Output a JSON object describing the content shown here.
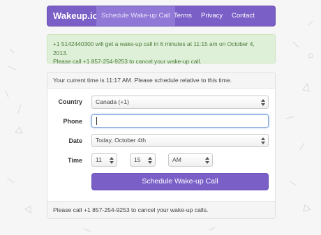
{
  "nav": {
    "brand": "Wakeup.io",
    "items": [
      {
        "label": "Schedule Wake-up Call",
        "active": true
      },
      {
        "label": "Terms",
        "active": false
      },
      {
        "label": "Privacy",
        "active": false
      },
      {
        "label": "Contact",
        "active": false
      }
    ]
  },
  "alert": {
    "line1": "+1 5142440300 will get a wake-up call in 6 minutes at 11:15 am on October 4, 2013.",
    "line2": "Please call +1 857-254-9253 to cancel your wake-up call."
  },
  "form": {
    "header": "Your current time is 11:17 AM. Please schedule relative to this time.",
    "country_label": "Country",
    "country_value": "Canada (+1)",
    "phone_label": "Phone",
    "phone_value": "",
    "date_label": "Date",
    "date_value": "Today, October 4th",
    "time_label": "Time",
    "hour_value": "11",
    "minute_value": "15",
    "ampm_value": "AM",
    "submit_label": "Schedule Wake-up Call",
    "footer": "Please call +1 857-254-9253 to cancel your wake-up calls."
  },
  "colors": {
    "brand": "#7a5fc7",
    "alert_bg": "#dff0d8",
    "alert_text": "#4a7a3a"
  }
}
